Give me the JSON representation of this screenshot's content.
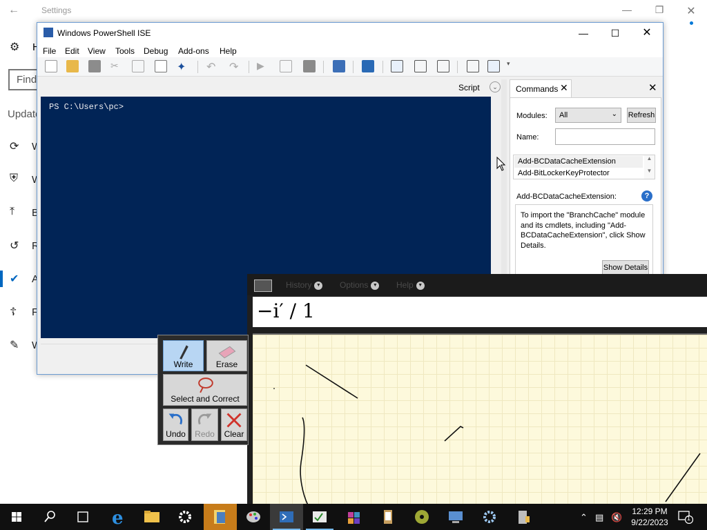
{
  "settings": {
    "title": "Settings",
    "home_letter": "H",
    "find_placeholder": "Find",
    "section_label": "Update",
    "nav_letters": [
      "W",
      "W",
      "B",
      "R",
      "A",
      "F",
      "W"
    ]
  },
  "ise": {
    "title": "Windows PowerShell ISE",
    "menu": [
      "File",
      "Edit",
      "View",
      "Tools",
      "Debug",
      "Add-ons",
      "Help"
    ],
    "script_label": "Script",
    "prompt": "PS C:\\Users\\pc>",
    "commands": {
      "tab_label": "Commands",
      "modules_label": "Modules:",
      "modules_value": "All",
      "refresh_label": "Refresh",
      "name_label": "Name:",
      "name_value": "",
      "list": [
        "Add-BCDataCacheExtension",
        "Add-BitLockerKeyProtector"
      ],
      "selected_command": "Add-BCDataCacheExtension:",
      "info_text": "To import the \"BranchCache\" module and its cmdlets, including \"Add-BCDataCacheExtension\", click Show Details.",
      "show_details_label": "Show Details"
    }
  },
  "math_panel": {
    "menu": [
      "History",
      "Options",
      "Help"
    ],
    "recognized": "−i′ / 1",
    "tools": {
      "write": "Write",
      "erase": "Erase",
      "select_correct": "Select and Correct",
      "undo": "Undo",
      "redo": "Redo",
      "clear": "Clear"
    }
  },
  "taskbar": {
    "time": "12:29 PM",
    "date": "9/22/2023",
    "notification_count": "1"
  },
  "colors": {
    "console_bg": "#012456",
    "accent": "#0078d7",
    "canvas_bg": "#fdf9dc",
    "taskbar_bg": "#101010",
    "highlight_orange": "#c77c1a"
  }
}
